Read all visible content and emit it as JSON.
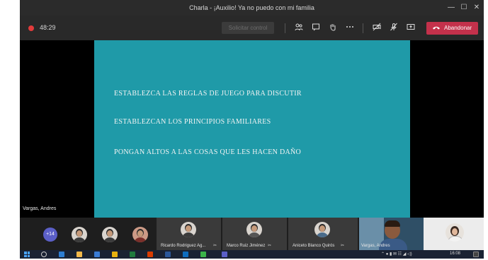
{
  "window": {
    "title": "Charla - ¡Auxilio! Ya no puedo con mi familia",
    "minimize": "—",
    "maximize": "☐",
    "close": "✕"
  },
  "toolbar": {
    "recording_time": "48:29",
    "request_control": "Solicitar control",
    "leave_label": "Abandonar",
    "icons": [
      "people-icon",
      "chat-icon",
      "raise-hand-icon",
      "more-icon",
      "camera-off-icon",
      "mic-off-icon",
      "share-icon"
    ]
  },
  "slide": {
    "lines": [
      "ESTABLEZCA LAS REGLAS DE JUEGO PARA DISCUTIR",
      "ESTABLEZCAN LOS PRINCIPIOS FAMILIARES",
      "PONGAN ALTOS A LAS COSAS QUE LES HACEN DAÑO"
    ],
    "background": "#1f9aa8"
  },
  "presenter_name": "Vargas, Andres",
  "participants": {
    "more_count": "+14",
    "tiles": [
      {
        "name": "Ricardo Rodriguez Ag..."
      },
      {
        "name": "Marco Ruiz Jiménez"
      },
      {
        "name": "Aniceto Blanco Quirós"
      },
      {
        "name": "Vargas, Andres"
      }
    ]
  },
  "taskbar": {
    "time": "16:08"
  },
  "colors": {
    "leave": "#c4314b",
    "accent": "#5b5fc7",
    "recording": "#e23b3b"
  }
}
